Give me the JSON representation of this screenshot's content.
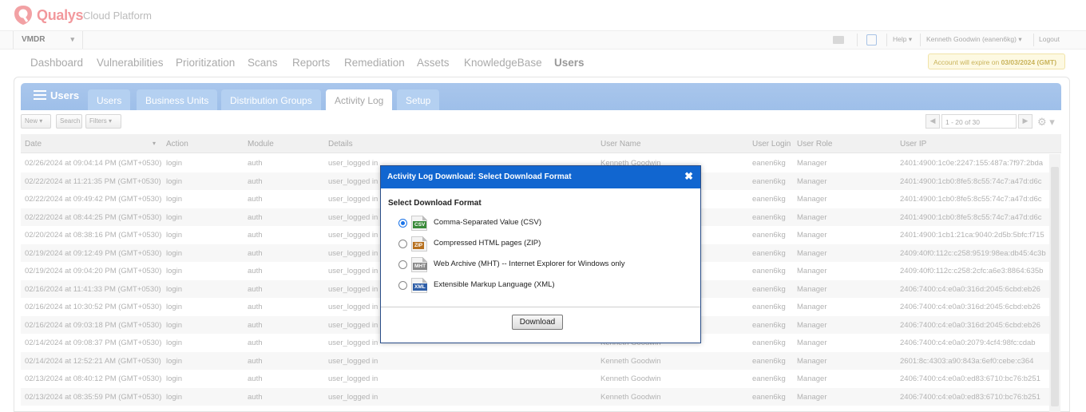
{
  "brand": {
    "name": "Qualys",
    "sub": "Cloud Platform"
  },
  "module_bar": {
    "module": "VMDR",
    "help": "Help",
    "user": "Kenneth Goodwin (eanen6kg)",
    "logout": "Logout"
  },
  "nav": {
    "items": [
      "Dashboard",
      "Vulnerabilities",
      "Prioritization",
      "Scans",
      "Reports",
      "Remediation",
      "Assets",
      "KnowledgeBase",
      "Users"
    ],
    "active": "Users",
    "expire_prefix": "Account will expire on ",
    "expire_date": "03/03/2024 (GMT)"
  },
  "panel": {
    "title": "Users",
    "tabs": [
      "Users",
      "Business Units",
      "Distribution Groups",
      "Activity Log",
      "Setup"
    ],
    "active_tab": "Activity Log",
    "toolbar": {
      "new": "New",
      "search": "Search",
      "filters": "Filters",
      "range": "1 - 20 of 30"
    }
  },
  "table": {
    "columns": [
      "Date",
      "Action",
      "Module",
      "Details",
      "User Name",
      "User Login",
      "User Role",
      "User IP"
    ],
    "rows": [
      [
        "02/26/2024 at 09:04:14 PM (GMT+0530)",
        "login",
        "auth",
        "user_logged in",
        "Kenneth Goodwin",
        "eanen6kg",
        "Manager",
        "2401:4900:1c0e:2247:155:487a:7f97:2bda"
      ],
      [
        "02/22/2024 at 11:21:35 PM (GMT+0530)",
        "login",
        "auth",
        "user_logged in",
        "",
        "eanen6kg",
        "Manager",
        "2401:4900:1cb0:8fe5:8c55:74c7:a47d:d6c"
      ],
      [
        "02/22/2024 at 09:49:42 PM (GMT+0530)",
        "login",
        "auth",
        "user_logged in",
        "",
        "eanen6kg",
        "Manager",
        "2401:4900:1cb0:8fe5:8c55:74c7:a47d:d6c"
      ],
      [
        "02/22/2024 at 08:44:25 PM (GMT+0530)",
        "login",
        "auth",
        "user_logged in",
        "",
        "eanen6kg",
        "Manager",
        "2401:4900:1cb0:8fe5:8c55:74c7:a47d:d6c"
      ],
      [
        "02/20/2024 at 08:38:16 PM (GMT+0530)",
        "login",
        "auth",
        "user_logged in",
        "",
        "eanen6kg",
        "Manager",
        "2401:4900:1cb1:21ca:9040:2d5b:5bfc:f715"
      ],
      [
        "02/19/2024 at 09:12:49 PM (GMT+0530)",
        "login",
        "auth",
        "user_logged in",
        "",
        "eanen6kg",
        "Manager",
        "2409:40f0:112c:c258:9519:98ea:db45:4c3b"
      ],
      [
        "02/19/2024 at 09:04:20 PM (GMT+0530)",
        "login",
        "auth",
        "user_logged in",
        "",
        "eanen6kg",
        "Manager",
        "2409:40f0:112c:c258:2cfc:a6e3:8864:635b"
      ],
      [
        "02/16/2024 at 11:41:33 PM (GMT+0530)",
        "login",
        "auth",
        "user_logged in",
        "",
        "eanen6kg",
        "Manager",
        "2406:7400:c4:e0a0:316d:2045:6cbd:eb26"
      ],
      [
        "02/16/2024 at 10:30:52 PM (GMT+0530)",
        "login",
        "auth",
        "user_logged in",
        "",
        "eanen6kg",
        "Manager",
        "2406:7400:c4:e0a0:316d:2045:6cbd:eb26"
      ],
      [
        "02/16/2024 at 09:03:18 PM (GMT+0530)",
        "login",
        "auth",
        "user_logged in",
        "",
        "eanen6kg",
        "Manager",
        "2406:7400:c4:e0a0:316d:2045:6cbd:eb26"
      ],
      [
        "02/14/2024 at 09:08:37 PM (GMT+0530)",
        "login",
        "auth",
        "user_logged in",
        "Kenneth Goodwin",
        "eanen6kg",
        "Manager",
        "2406:7400:c4:e0a0:2079:4cf4:98fc:cdab"
      ],
      [
        "02/14/2024 at 12:52:21 AM (GMT+0530)",
        "login",
        "auth",
        "user_logged in",
        "Kenneth Goodwin",
        "eanen6kg",
        "Manager",
        "2601:8c:4303:a90:843a:6ef0:cebe:c364"
      ],
      [
        "02/13/2024 at 08:40:12 PM (GMT+0530)",
        "login",
        "auth",
        "user_logged in",
        "Kenneth Goodwin",
        "eanen6kg",
        "Manager",
        "2406:7400:c4:e0a0:ed83:6710:bc76:b251"
      ],
      [
        "02/13/2024 at 08:35:59 PM (GMT+0530)",
        "login",
        "auth",
        "user_logged in",
        "Kenneth Goodwin",
        "eanen6kg",
        "Manager",
        "2406:7400:c4:e0a0:ed83:6710:bc76:b251"
      ]
    ]
  },
  "dialog": {
    "title": "Activity Log Download: Select Download Format",
    "close": "✖",
    "label": "Select Download Format",
    "options": [
      {
        "tag": "CSV",
        "label": "Comma-Separated Value (CSV)",
        "color": "#3a8a3a",
        "selected": true
      },
      {
        "tag": "ZIP",
        "label": "Compressed HTML pages (ZIP)",
        "color": "#b7701f",
        "selected": false
      },
      {
        "tag": "MHT",
        "label": "Web Archive (MHT) -- Internet Explorer for Windows only",
        "color": "#888888",
        "selected": false
      },
      {
        "tag": "XML",
        "label": "Extensible Markup Language (XML)",
        "color": "#2f5fa8",
        "selected": false
      }
    ],
    "button": "Download"
  }
}
